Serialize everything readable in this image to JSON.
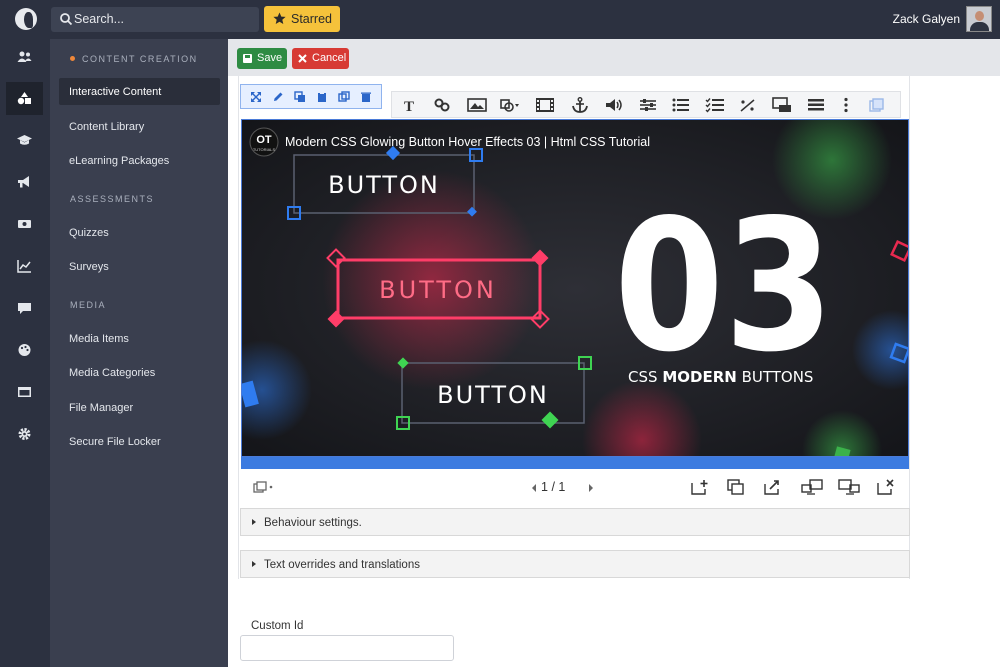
{
  "topbar": {
    "search_placeholder": "Search...",
    "starred_label": "Starred",
    "user_name": "Zack Galyen"
  },
  "rail": {
    "icons": [
      "users-icon",
      "shapes-icon",
      "graduation-cap-icon",
      "megaphone-icon",
      "ticket-icon",
      "chart-icon",
      "chat-icon",
      "palette-icon",
      "window-icon",
      "gear-icon"
    ],
    "active_index": 1
  },
  "sidebar": {
    "sections": [
      {
        "title": "CONTENT CREATION",
        "items": [
          "Interactive Content",
          "Content Library",
          "eLearning Packages"
        ]
      },
      {
        "title": "ASSESSMENTS",
        "items": [
          "Quizzes",
          "Surveys"
        ]
      },
      {
        "title": "MEDIA",
        "items": [
          "Media Items",
          "Media Categories",
          "File Manager",
          "Secure File Locker"
        ]
      }
    ],
    "active_item": "Interactive Content"
  },
  "actions": {
    "save_label": "Save",
    "cancel_label": "Cancel"
  },
  "toolbar": {
    "element_tools": [
      "expand-icon",
      "pencil-icon",
      "copy-icon",
      "paste-icon",
      "duplicate-icon",
      "trash-icon"
    ],
    "tools": [
      "text-icon",
      "link-icon",
      "image-icon",
      "shape-icon",
      "film-icon",
      "anchor-icon",
      "audio-icon",
      "sliders-icon",
      "list-icon",
      "checklist-icon",
      "fill-blank-icon",
      "dialog-icon",
      "menu-list-icon",
      "more-icon",
      "layers-icon"
    ]
  },
  "video": {
    "channel_badge": "OT",
    "channel_badge_sub": "TUTORIALS",
    "title": "Modern CSS Glowing Button Hover Effects 03 | Html CSS Tutorial",
    "button_text": "BUTTON",
    "big_number": "03",
    "subtitle_light": "CSS",
    "subtitle_bold": "MODERN",
    "subtitle_tail": "BUTTONS"
  },
  "pager": {
    "current": "1",
    "separator": "/",
    "total": "1"
  },
  "accordions": [
    "Behaviour settings.",
    "Text overrides and translations"
  ],
  "form": {
    "custom_id_label": "Custom Id",
    "custom_id_value": ""
  },
  "colors": {
    "accent_blue": "#3c7be0",
    "save_green": "#2e8b43",
    "cancel_red": "#d73a34",
    "starred_yellow": "#f5c23b",
    "sidebar": "#3a3f4f",
    "topbar": "#2c3140"
  }
}
